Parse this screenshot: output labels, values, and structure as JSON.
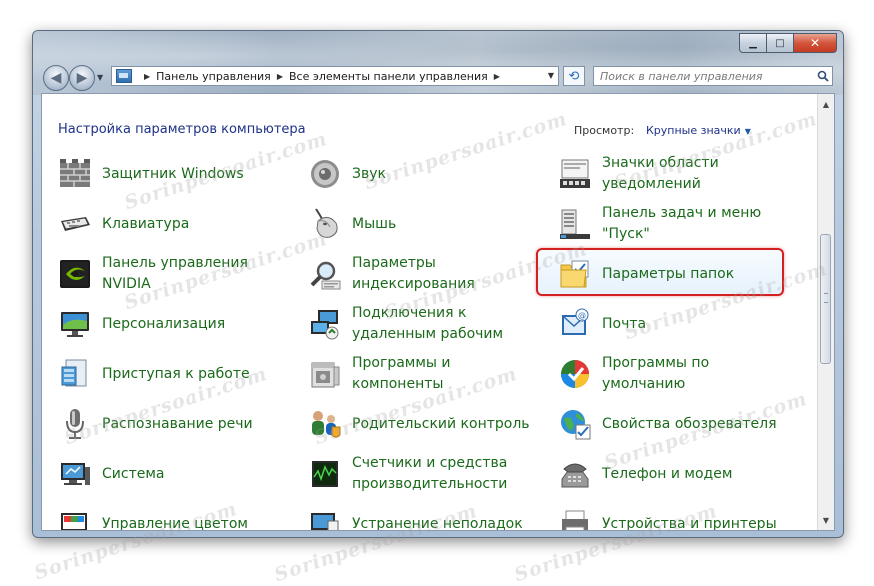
{
  "window": {
    "caption": {
      "minimize": "▁",
      "maximize": "□",
      "close": "✕"
    }
  },
  "nav": {
    "back_glyph": "◀",
    "forward_glyph": "▶",
    "breadcrumb": [
      "Панель управления",
      "Все элементы панели управления"
    ],
    "search_placeholder": "Поиск в панели управления"
  },
  "content": {
    "title": "Настройка параметров компьютера",
    "view_by_label": "Просмотр:",
    "view_mode": "Крупные значки"
  },
  "items": [
    [
      {
        "id": "windows-firewall",
        "label": "Защитник Windows",
        "icon": "wall-icon"
      },
      {
        "id": "keyboard",
        "label": "Клавиатура",
        "icon": "keyboard-icon"
      },
      {
        "id": "nvidia-control-panel",
        "label": "Панель управления NVIDIA",
        "icon": "nvidia-icon"
      },
      {
        "id": "personalization",
        "label": "Персонализация",
        "icon": "monitor-icon"
      },
      {
        "id": "getting-started",
        "label": "Приступая к работе",
        "icon": "getting-started-icon"
      },
      {
        "id": "speech-recognition",
        "label": "Распознавание речи",
        "icon": "microphone-icon"
      },
      {
        "id": "system",
        "label": "Система",
        "icon": "computer-icon"
      },
      {
        "id": "color-management",
        "label": "Управление цветом",
        "icon": "color-icon"
      }
    ],
    [
      {
        "id": "sound",
        "label": "Звук",
        "icon": "speaker-icon"
      },
      {
        "id": "mouse",
        "label": "Мышь",
        "icon": "mouse-icon"
      },
      {
        "id": "indexing-options",
        "label": "Параметры индексирования",
        "icon": "magnifier-icon"
      },
      {
        "id": "remote-desktop",
        "label": "Подключения к удаленным рабочим",
        "icon": "network-icon"
      },
      {
        "id": "programs-features",
        "label": "Программы и компоненты",
        "icon": "box-icon"
      },
      {
        "id": "parental-controls",
        "label": "Родительский контроль",
        "icon": "family-icon"
      },
      {
        "id": "performance",
        "label": "Счетчики и средства производительности",
        "icon": "gauge-icon"
      },
      {
        "id": "troubleshooting",
        "label": "Устранение неполадок",
        "icon": "troubleshoot-icon"
      }
    ],
    [
      {
        "id": "notification-icons",
        "label": "Значки области уведомлений",
        "icon": "tray-icon"
      },
      {
        "id": "taskbar-start",
        "label": "Панель задач и меню \"Пуск\"",
        "icon": "taskbar-icon"
      },
      {
        "id": "folder-options",
        "label": "Параметры папок",
        "icon": "folder-icon",
        "highlighted": true
      },
      {
        "id": "mail",
        "label": "Почта",
        "icon": "mail-icon"
      },
      {
        "id": "default-programs",
        "label": "Программы по умолчанию",
        "icon": "default-programs-icon"
      },
      {
        "id": "internet-options",
        "label": "Свойства обозревателя",
        "icon": "globe-icon"
      },
      {
        "id": "phone-modem",
        "label": "Телефон и модем",
        "icon": "phone-icon"
      },
      {
        "id": "devices-printers",
        "label": "Устройства и принтеры",
        "icon": "printer-icon"
      }
    ]
  ],
  "watermark": "Sorinpersoair.com",
  "colors": {
    "title_blue": "#1e3287",
    "item_green": "#1b6a1b",
    "highlight_red": "#d42020"
  }
}
